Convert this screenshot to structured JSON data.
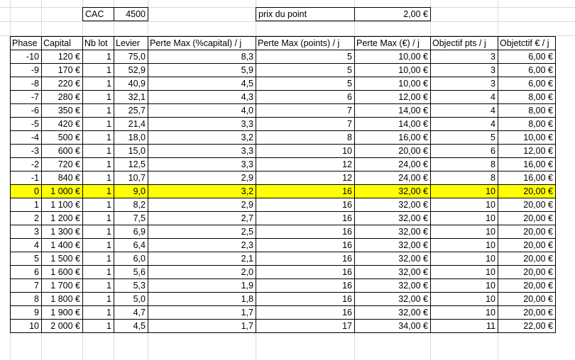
{
  "top": {
    "cac_label": "CAC",
    "cac_value": "4500",
    "point_label": "prix du point",
    "point_value": "2,00 €"
  },
  "headers": [
    "Phase",
    "Capital",
    "Nb lot",
    "Levier",
    "Perte Max (%capital) / j",
    "Perte Max (points) / j",
    "Perte Max (€) / j",
    "Objectif pts / j",
    "Objetctif € / j"
  ],
  "rows": [
    [
      "-10",
      "120 €",
      "1",
      "75,0",
      "8,3",
      "5",
      "10,00 €",
      "3",
      "6,00 €"
    ],
    [
      "-9",
      "170 €",
      "1",
      "52,9",
      "5,9",
      "5",
      "10,00 €",
      "3",
      "6,00 €"
    ],
    [
      "-8",
      "220 €",
      "1",
      "40,9",
      "4,5",
      "5",
      "10,00 €",
      "3",
      "6,00 €"
    ],
    [
      "-7",
      "280 €",
      "1",
      "32,1",
      "4,3",
      "6",
      "12,00 €",
      "4",
      "8,00 €"
    ],
    [
      "-6",
      "350 €",
      "1",
      "25,7",
      "4,0",
      "7",
      "14,00 €",
      "4",
      "8,00 €"
    ],
    [
      "-5",
      "420 €",
      "1",
      "21,4",
      "3,3",
      "7",
      "14,00 €",
      "4",
      "8,00 €"
    ],
    [
      "-4",
      "500 €",
      "1",
      "18,0",
      "3,2",
      "8",
      "16,00 €",
      "5",
      "10,00 €"
    ],
    [
      "-3",
      "600 €",
      "1",
      "15,0",
      "3,3",
      "10",
      "20,00 €",
      "6",
      "12,00 €"
    ],
    [
      "-2",
      "720 €",
      "1",
      "12,5",
      "3,3",
      "12",
      "24,00 €",
      "8",
      "16,00 €"
    ],
    [
      "-1",
      "840 €",
      "1",
      "10,7",
      "2,9",
      "12",
      "24,00 €",
      "8",
      "16,00 €"
    ],
    [
      "0",
      "1 000 €",
      "1",
      "9,0",
      "3,2",
      "16",
      "32,00 €",
      "10",
      "20,00 €"
    ],
    [
      "1",
      "1 100 €",
      "1",
      "8,2",
      "2,9",
      "16",
      "32,00 €",
      "10",
      "20,00 €"
    ],
    [
      "2",
      "1 200 €",
      "1",
      "7,5",
      "2,7",
      "16",
      "32,00 €",
      "10",
      "20,00 €"
    ],
    [
      "3",
      "1 300 €",
      "1",
      "6,9",
      "2,5",
      "16",
      "32,00 €",
      "10",
      "20,00 €"
    ],
    [
      "4",
      "1 400 €",
      "1",
      "6,4",
      "2,3",
      "16",
      "32,00 €",
      "10",
      "20,00 €"
    ],
    [
      "5",
      "1 500 €",
      "1",
      "6,0",
      "2,1",
      "16",
      "32,00 €",
      "10",
      "20,00 €"
    ],
    [
      "6",
      "1 600 €",
      "1",
      "5,6",
      "2,0",
      "16",
      "32,00 €",
      "10",
      "20,00 €"
    ],
    [
      "7",
      "1 700 €",
      "1",
      "5,3",
      "1,9",
      "16",
      "32,00 €",
      "10",
      "20,00 €"
    ],
    [
      "8",
      "1 800 €",
      "1",
      "5,0",
      "1,8",
      "16",
      "32,00 €",
      "10",
      "20,00 €"
    ],
    [
      "9",
      "1 900 €",
      "1",
      "4,7",
      "1,7",
      "16",
      "32,00 €",
      "10",
      "20,00 €"
    ],
    [
      "10",
      "2 000 €",
      "1",
      "4,5",
      "1,7",
      "17",
      "34,00 €",
      "11",
      "22,00 €"
    ]
  ],
  "highlight_row": 10,
  "highlight_color": "#ffff00"
}
